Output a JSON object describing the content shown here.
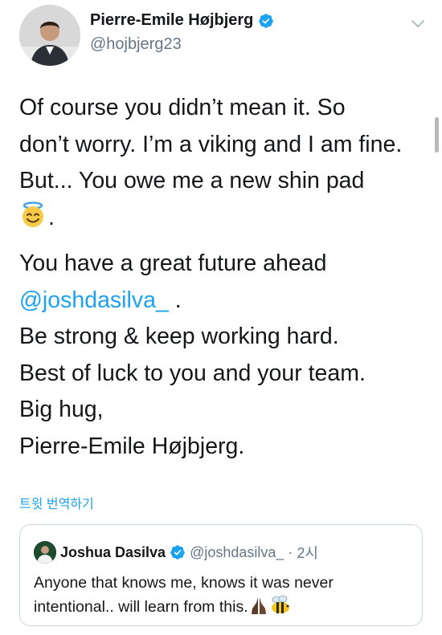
{
  "author": {
    "display_name": "Pierre-Emile Højbjerg",
    "handle": "@hojbjerg23"
  },
  "tweet": {
    "line1": "Of course you didn’t mean it. So",
    "line2": "don’t worry. I’m a viking and I am fine.",
    "line3": "But... You owe me a new shin pad",
    "line4_suffix": ".",
    "line5": "You have a great future ahead",
    "mention": "@joshdasilva_",
    "line6_suffix": " .",
    "line7": "Be strong & keep working hard.",
    "line8": "Best of luck to you and your team.",
    "line9": "Big hug,",
    "line10": "Pierre-Emile Højbjerg."
  },
  "translate_label": "트윗 번역하기",
  "quoted_tweet": {
    "display_name": "Joshua Dasilva",
    "handle": "@joshdasilva_",
    "separator": "·",
    "time": "2시",
    "text": "Anyone that knows me, knows it was never intentional.. will learn from this."
  },
  "icons": {
    "verified": "verified-badge-icon",
    "chevron": "chevron-down-icon",
    "halo_emoji": "smiling-face-with-halo-emoji",
    "praying_emoji": "folded-hands-emoji",
    "bee_emoji": "honeybee-emoji"
  },
  "colors": {
    "accent": "#1da1f2",
    "text": "#14171a",
    "muted": "#657786",
    "border": "#ccd6dd"
  }
}
